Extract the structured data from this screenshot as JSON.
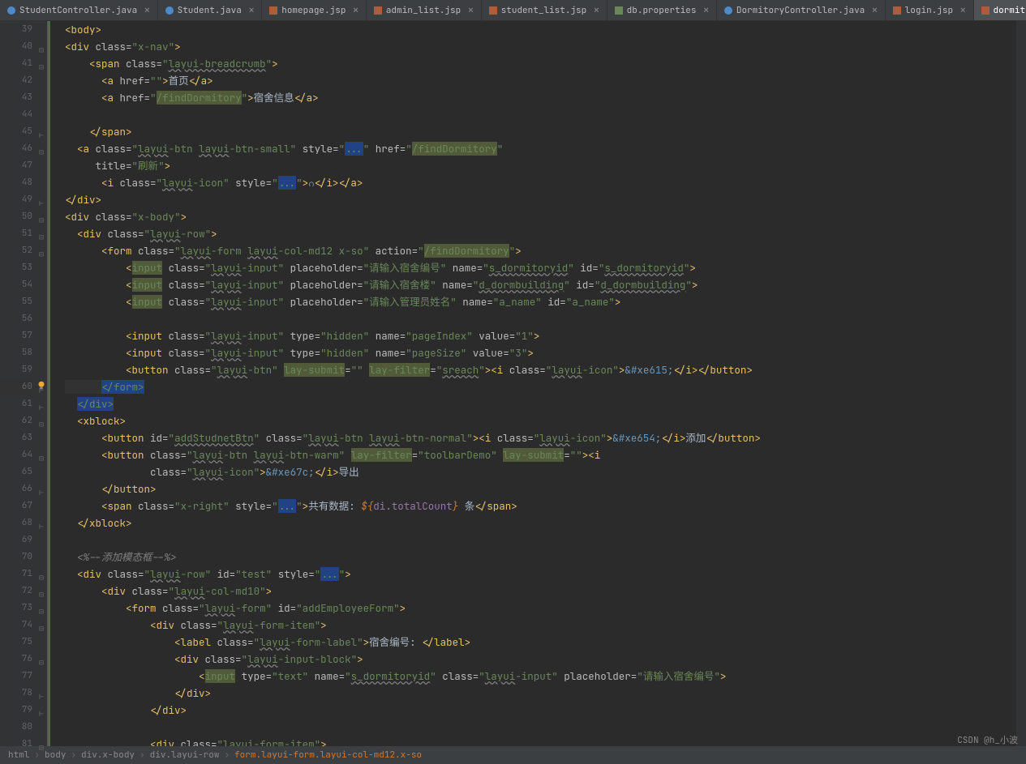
{
  "tabs": [
    {
      "name": "StudentController.java",
      "type": "java"
    },
    {
      "name": "Student.java",
      "type": "java"
    },
    {
      "name": "homepage.jsp",
      "type": "jsp"
    },
    {
      "name": "admin_list.jsp",
      "type": "jsp"
    },
    {
      "name": "student_list.jsp",
      "type": "jsp"
    },
    {
      "name": "db.properties",
      "type": "prop"
    },
    {
      "name": "DormitoryController.java",
      "type": "java"
    },
    {
      "name": "login.jsp",
      "type": "jsp"
    },
    {
      "name": "dormitory_list.jsp",
      "type": "jsp",
      "active": true
    }
  ],
  "line_start": 39,
  "line_end": 81,
  "code": {
    "l39": {
      "indent": 2,
      "body_close": "<body>"
    },
    "l40": {
      "div_xnav": "x-nav"
    },
    "l41": {
      "span_bc": "layui-breadcrumb"
    },
    "l42": {
      "a_href": "",
      "a_text": "首页"
    },
    "l43": {
      "a_href": "/findDormitory",
      "a_text": "宿舍信息"
    },
    "l45": {
      "close_span": "</span>"
    },
    "l46": {
      "a_class": "layui-btn layui-btn-small",
      "style": "...",
      "href": "/findDormitory"
    },
    "l47": {
      "title": "刷新"
    },
    "l48": {
      "i_class": "layui-icon",
      "i_style": "...",
      "i_text": "ဂ"
    },
    "l49": {
      "close_div": "</div>"
    },
    "l50": {
      "div_xbody": "x-body"
    },
    "l51": {
      "div_row": "layui-row"
    },
    "l52": {
      "form_class": "layui-form layui-col-md12 x-so",
      "action": "/findDormitory"
    },
    "l53": {
      "input_cls": "layui-input",
      "ph": "请输入宿舍编号",
      "name": "s_dormitoryid",
      "id": "s_dormitoryid"
    },
    "l54": {
      "input_cls": "layui-input",
      "ph": "请输入宿舍楼",
      "name": "d_dormbuilding",
      "id": "d_dormbuilding"
    },
    "l55": {
      "input_cls": "layui-input",
      "ph": "请输入管理员姓名",
      "name": "a_name",
      "id": "a_name"
    },
    "l57": {
      "input_cls": "layui-input",
      "type": "hidden",
      "name": "pageIndex",
      "value": "1"
    },
    "l58": {
      "input_cls": "layui-input",
      "type": "hidden",
      "name": "pageSize",
      "value": "3"
    },
    "l59": {
      "btn_cls": "layui-btn",
      "lay_submit": "",
      "lay_filter": "sreach",
      "i_cls": "layui-icon",
      "entity": "&#xe615;"
    },
    "l60": {
      "close_form": "</form>"
    },
    "l61": {
      "close_div": "</div>"
    },
    "l62": {
      "xblock": "<xblock>"
    },
    "l63": {
      "btn_id": "addStudnetBtn",
      "btn_cls": "layui-btn layui-btn-normal",
      "i_cls": "layui-icon",
      "entity": "&#xe654;",
      "text": "添加"
    },
    "l64": {
      "btn_cls": "layui-btn layui-btn-warm",
      "lay_filter": "toolbarDemo",
      "lay_submit": ""
    },
    "l65": {
      "i_cls": "layui-icon",
      "entity": "&#xe67c;",
      "text": "导出"
    },
    "l66": {
      "close_btn": "</button>"
    },
    "l67": {
      "span_cls": "x-right",
      "style": "...",
      "text_pre": "共有数据: ",
      "el": "${di.totalCount}",
      "text_post": " 条"
    },
    "l68": {
      "close_xblock": "</xblock>"
    },
    "l70": {
      "comment": "<%--添加模态框--%>"
    },
    "l71": {
      "div_cls": "layui-row",
      "id": "test",
      "style": "..."
    },
    "l72": {
      "div_cls": "layui-col-md10"
    },
    "l73": {
      "form_cls": "layui-form",
      "id": "addEmployeeForm"
    },
    "l74": {
      "div_cls": "layui-form-item"
    },
    "l75": {
      "label_cls": "layui-form-label",
      "text": "宿舍编号: "
    },
    "l76": {
      "div_cls": "layui-input-block"
    },
    "l77": {
      "type": "text",
      "name": "s_dormitoryid",
      "cls": "layui-input",
      "ph": "请输入宿舍编号"
    },
    "l78": {
      "close_div": "</div>"
    },
    "l79": {
      "close_div": "</div>"
    },
    "l81": {
      "div_cls": "layui-form-item"
    }
  },
  "breadcrumb": {
    "items": [
      "html",
      "body",
      "div.x-body",
      "div.layui-row",
      "form.layui-form.layui-col-md12.x-so"
    ]
  },
  "watermark": "CSDN @h_小波"
}
